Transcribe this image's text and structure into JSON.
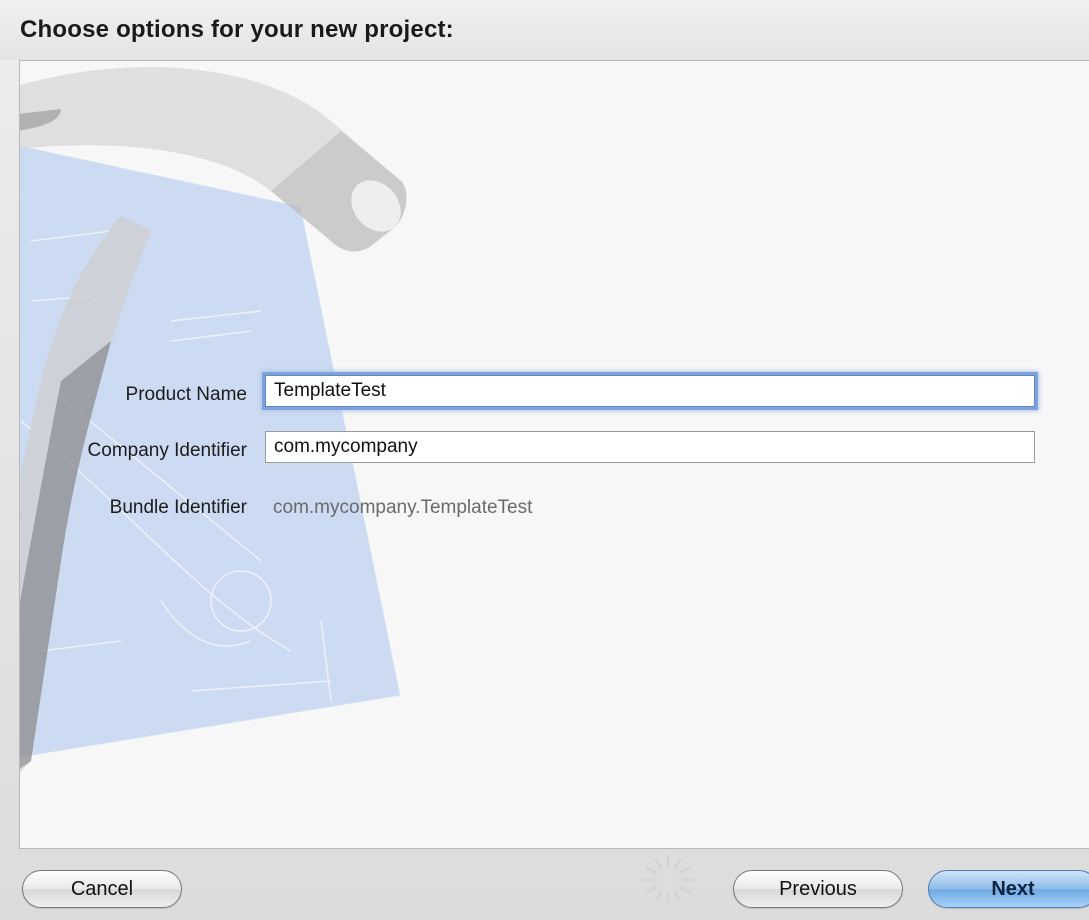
{
  "header": {
    "title": "Choose options for your new project:"
  },
  "form": {
    "product_name": {
      "label": "Product Name",
      "value": "TemplateTest"
    },
    "company_identifier": {
      "label": "Company Identifier",
      "value": "com.mycompany"
    },
    "bundle_identifier": {
      "label": "Bundle Identifier",
      "value": "com.mycompany.TemplateTest"
    }
  },
  "footer": {
    "cancel_label": "Cancel",
    "previous_label": "Previous",
    "next_label": "Next"
  },
  "icons": {
    "watermark": "xcode-hammer-blueprint-icon",
    "spinner": "progress-spinner-icon"
  },
  "colors": {
    "accent": "#6da8e2",
    "focus_ring": "#7fa3d8"
  }
}
